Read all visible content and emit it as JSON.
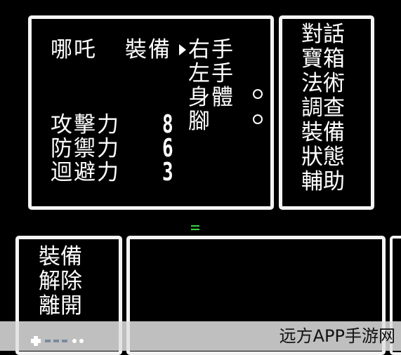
{
  "status": {
    "character_name": "哪吒",
    "equip_title": "裝備",
    "slots": [
      "右手",
      "左手",
      "身體",
      "腳"
    ],
    "stats": [
      {
        "label": "攻擊力",
        "value": "8"
      },
      {
        "label": "防禦力",
        "value": "6"
      },
      {
        "label": "迴避力",
        "value": "3"
      }
    ]
  },
  "command_menu": {
    "items": [
      "對話",
      "寶箱",
      "法術",
      "調查",
      "裝備",
      "狀態",
      "輔助"
    ]
  },
  "equip_menu": {
    "items": [
      "裝備",
      "解除",
      "離開"
    ]
  },
  "watermark": {
    "text": "远方APP手游网"
  },
  "colors": {
    "background": "#000000",
    "border": "#f4f4f4",
    "text": "#ffffff",
    "cursor_green": "#3cd23c"
  },
  "icons": {
    "cursor": "right-triangle-cursor",
    "equipped_marker": "ring-marker"
  }
}
